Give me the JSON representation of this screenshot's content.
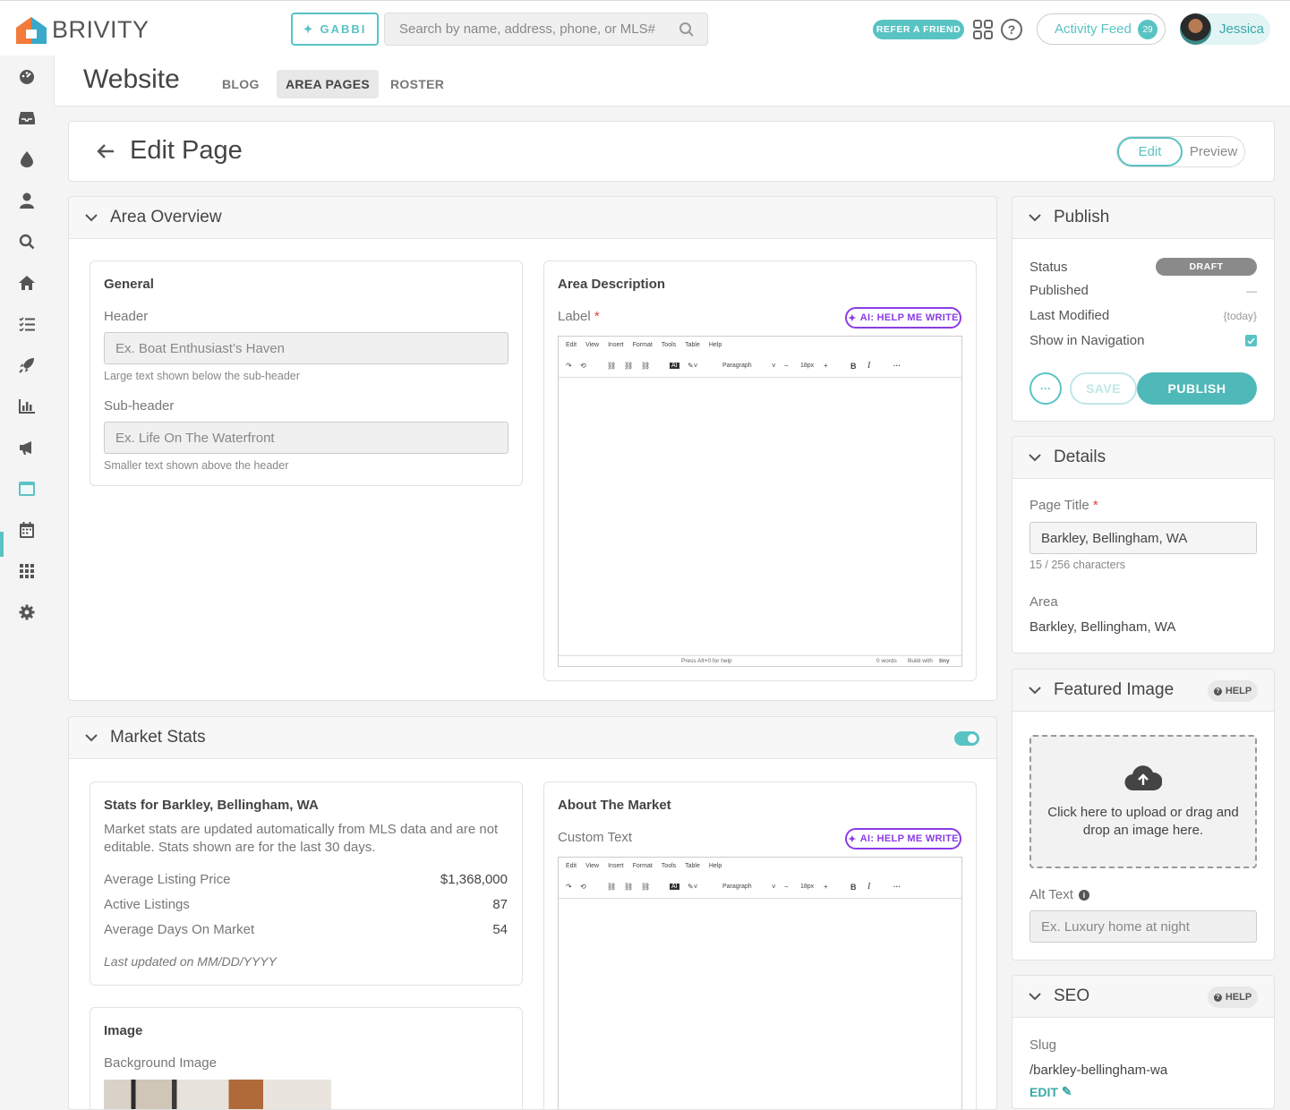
{
  "header": {
    "brand": "BRIVITY",
    "gabbi_label": "GABBI",
    "search_placeholder": "Search by name, address, phone, or MLS#",
    "refer_label": "REFER A FRIEND",
    "activity_label": "Activity Feed",
    "activity_count": "29",
    "user_name": "Jessica"
  },
  "sidebar": {
    "items": [
      "dashboard-icon",
      "inbox-icon",
      "drop-icon",
      "person-icon",
      "search-icon",
      "home-icon",
      "checklist-icon",
      "rocket-icon",
      "chart-icon",
      "megaphone-icon",
      "website-icon",
      "calendar-icon",
      "apps-icon",
      "gear-icon"
    ],
    "active": "website-icon"
  },
  "subnav": {
    "title": "Website",
    "tabs": [
      "BLOG",
      "AREA PAGES",
      "ROSTER"
    ],
    "active_tab": "AREA PAGES"
  },
  "editbar": {
    "title": "Edit Page",
    "mode_edit": "Edit",
    "mode_preview": "Preview"
  },
  "area_overview": {
    "title": "Area Overview",
    "general": {
      "title": "General",
      "header_label": "Header",
      "header_placeholder": "Ex. Boat Enthusiast’s Haven",
      "header_hint": "Large text shown below the sub-header",
      "subheader_label": "Sub-header",
      "subheader_placeholder": "Ex. Life On The Waterfront",
      "subheader_hint": "Smaller text shown above the header"
    },
    "description": {
      "title": "Area Description",
      "label": "Label",
      "required": "*",
      "ai_label": "AI: HELP ME WRITE"
    }
  },
  "editor": {
    "menu": [
      "Edit",
      "View",
      "Insert",
      "Format",
      "Tools",
      "Table",
      "Help"
    ],
    "block_format": "Paragraph",
    "font_size": "18px",
    "status_help": "Press Alt+0 for help",
    "status_words": "0 words",
    "status_built": "Build with",
    "status_brand": "tiny"
  },
  "market_stats": {
    "title": "Market Stats",
    "enabled": true,
    "stats_card": {
      "title": "Stats for Barkley, Bellingham, WA",
      "description": "Market stats are updated automatically from MLS data and are not editable. Stats shown are for the last 30 days.",
      "rows": [
        {
          "label": "Average Listing Price",
          "value": "$1,368,000"
        },
        {
          "label": "Active Listings",
          "value": "87"
        },
        {
          "label": "Average Days On Market",
          "value": "54"
        }
      ],
      "updated": "Last updated on MM/DD/YYYY"
    },
    "about": {
      "title": "About The Market",
      "label": "Custom Text",
      "ai_label": "AI: HELP ME WRITE"
    },
    "image": {
      "title": "Image",
      "bg_label": "Background Image"
    }
  },
  "publish": {
    "title": "Publish",
    "status_label": "Status",
    "status_value": "DRAFT",
    "published_label": "Published",
    "published_value": "—",
    "modified_label": "Last Modified",
    "modified_value": "{today}",
    "nav_label": "Show in Navigation",
    "show_in_nav": true,
    "more_label": "···",
    "save_label": "SAVE",
    "publish_label": "PUBLISH"
  },
  "details": {
    "title": "Details",
    "page_title_label": "Page Title",
    "required": "*",
    "page_title_value": "Barkley, Bellingham, WA",
    "char_count": "15 / 256 characters",
    "area_label": "Area",
    "area_value": "Barkley, Bellingham, WA"
  },
  "featured_image": {
    "title": "Featured Image",
    "help_label": "HELP",
    "upload_text": "Click here to upload or drag and drop an image here.",
    "alt_label": "Alt Text",
    "alt_placeholder": "Ex. Luxury home at night"
  },
  "seo": {
    "title": "SEO",
    "help_label": "HELP",
    "slug_label": "Slug",
    "slug_value": "/barkley-bellingham-wa",
    "edit_label": "EDIT"
  },
  "colors": {
    "accent": "#59c3c3",
    "ai": "#8a3ce6",
    "required": "#e04040",
    "draft": "#8a8a8a"
  }
}
